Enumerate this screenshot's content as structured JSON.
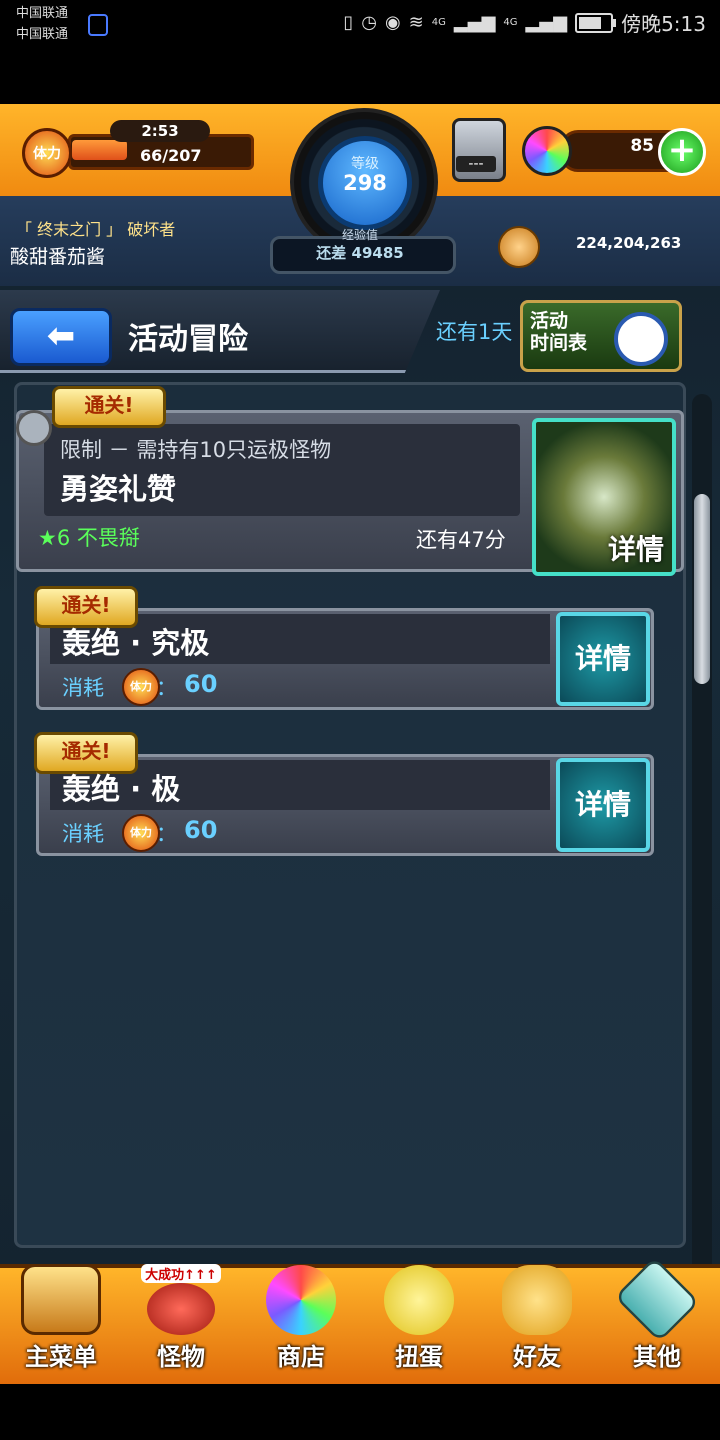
{
  "status_bar": {
    "carrier_1": "中国联通",
    "carrier_2": "中国联通",
    "network_1": "4G",
    "network_2": "4G",
    "time": "傍晚5:13"
  },
  "header": {
    "stamina_icon_label": "体力",
    "stamina_timer": "2:53",
    "stamina_value": "66/207",
    "stamina_fraction": 0.32,
    "level_label": "等级",
    "level": "298",
    "exp_label": "经验值",
    "exp_remaining": "还差 49485",
    "tool_counter": "---",
    "gems": "85",
    "coins": "224,204,263",
    "player_title": "「 终末之门 」 破坏者",
    "player_name": "酸甜番茄酱"
  },
  "page": {
    "title": "活动冒险",
    "remaining": "还有1天",
    "schedule_label": "活动\n时间表"
  },
  "cards": [
    {
      "badge": "通关!",
      "limit": "限制 － 需持有10只运极怪物",
      "name": "勇姿礼赞",
      "difficulty": "★6 不畏搿",
      "countdown": "还有47分",
      "detail": "详情"
    },
    {
      "badge": "通关!",
      "name": "轰绝 · 究极",
      "cost_label": "消耗",
      "cost_icon": "体力",
      "cost_sep": "：",
      "cost_value": "60",
      "detail": "详情"
    },
    {
      "badge": "通关!",
      "name": "轰绝 · 极",
      "cost_label": "消耗",
      "cost_icon": "体力",
      "cost_sep": "：",
      "cost_value": "60",
      "detail": "详情"
    }
  ],
  "nav": [
    {
      "label": "主菜单",
      "icon": "main-menu-icon"
    },
    {
      "label": "怪物",
      "icon": "monster-icon",
      "tag": "大成功↑↑↑"
    },
    {
      "label": "商店",
      "icon": "shop-icon"
    },
    {
      "label": "扭蛋",
      "icon": "gacha-icon"
    },
    {
      "label": "好友",
      "icon": "friends-icon"
    },
    {
      "label": "其他",
      "icon": "other-icon"
    }
  ]
}
